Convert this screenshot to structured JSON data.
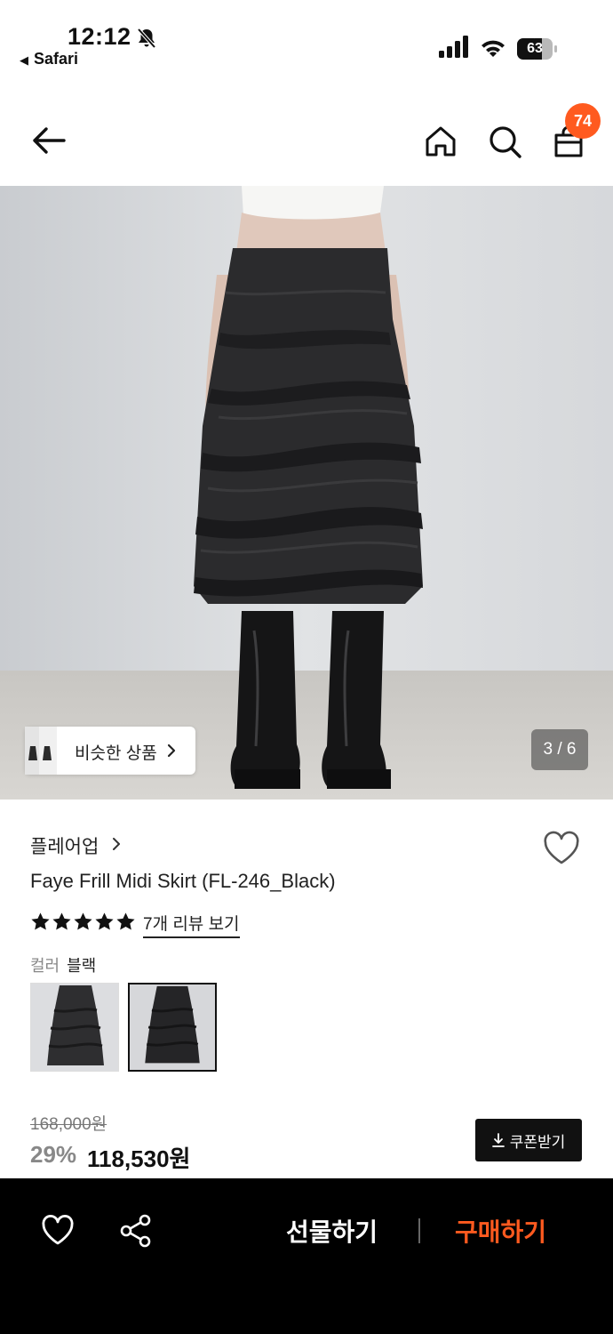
{
  "status_bar": {
    "time": "12:12",
    "back_app": "Safari",
    "battery": "63",
    "icons": [
      "bell-slash-icon",
      "signal-icon",
      "wifi-icon",
      "battery-icon"
    ]
  },
  "header": {
    "icons": [
      "back-arrow-icon",
      "home-icon",
      "search-icon",
      "shopping-bag-icon"
    ],
    "cart_count": "74"
  },
  "gallery": {
    "similar_label": "비슷한 상품",
    "counter": "3 / 6"
  },
  "product": {
    "brand": "플레어업",
    "name": "Faye Frill Midi Skirt (FL-246_Black)",
    "rating_stars": 5,
    "review_link": "7개 리뷰 보기",
    "color_key": "컬러",
    "color_value": "블랙"
  },
  "price": {
    "original": "168,000원",
    "discount": "29%",
    "sale": "118,530원",
    "coupon_label": "쿠폰받기"
  },
  "bottom_bar": {
    "gift_label": "선물하기",
    "buy_label": "구매하기",
    "icons": [
      "heart-icon",
      "share-icon"
    ]
  },
  "colors": {
    "accent": "#ff5a1f",
    "dark": "#111111"
  }
}
